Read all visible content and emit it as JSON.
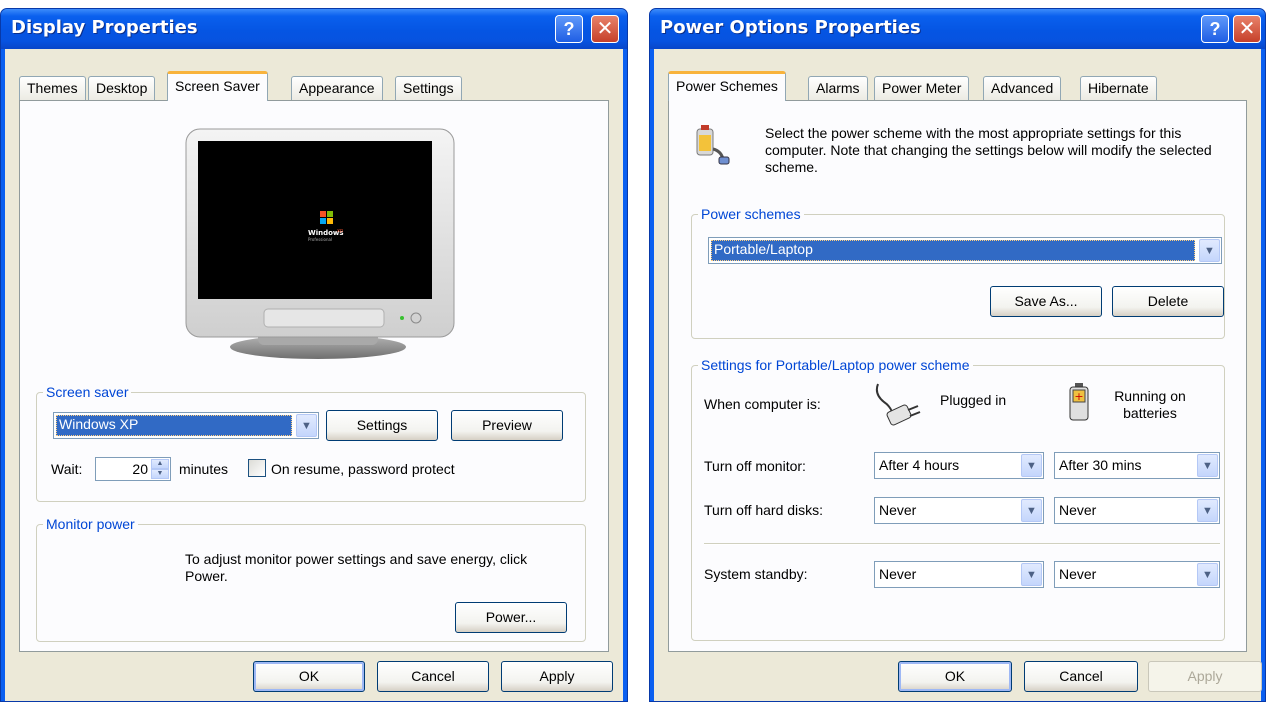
{
  "display_window": {
    "title": "Display Properties",
    "help_button": "?",
    "close_button": "✕",
    "tabs": [
      "Themes",
      "Desktop",
      "Screen Saver",
      "Appearance",
      "Settings"
    ],
    "active_tab": "Screen Saver",
    "screen_saver_group": {
      "label": "Screen saver",
      "selected": "Windows XP",
      "settings_button": "Settings",
      "preview_button": "Preview",
      "wait_label": "Wait:",
      "wait_value": "20",
      "minutes_label": "minutes",
      "password_checkbox_label": "On resume, password protect",
      "password_checked": false
    },
    "monitor_power_group": {
      "label": "Monitor power",
      "description": "To adjust monitor power settings and save energy, click Power.",
      "power_button": "Power..."
    },
    "preview_logo": {
      "line1": "Windows",
      "line2": "xp",
      "line3": "Professional"
    },
    "buttons": {
      "ok": "OK",
      "cancel": "Cancel",
      "apply": "Apply"
    }
  },
  "power_window": {
    "title": "Power Options Properties",
    "help_button": "?",
    "close_button": "✕",
    "tabs": [
      "Power Schemes",
      "Alarms",
      "Power Meter",
      "Advanced",
      "Hibernate"
    ],
    "active_tab": "Power Schemes",
    "description": "Select the power scheme with the most appropriate settings for this computer. Note that changing the settings below will modify the selected scheme.",
    "schemes_group": {
      "label": "Power schemes",
      "selected": "Portable/Laptop",
      "save_as_button": "Save As...",
      "delete_button": "Delete"
    },
    "settings_group": {
      "label": "Settings for Portable/Laptop power scheme",
      "when_label": "When computer is:",
      "plugged_in": "Plugged in",
      "batteries": "Running on batteries",
      "rows": [
        {
          "label": "Turn off monitor:",
          "plugged": "After 4 hours",
          "battery": "After 30 mins"
        },
        {
          "label": "Turn off hard disks:",
          "plugged": "Never",
          "battery": "Never"
        },
        {
          "label": "System standby:",
          "plugged": "Never",
          "battery": "Never"
        }
      ]
    },
    "buttons": {
      "ok": "OK",
      "cancel": "Cancel",
      "apply": "Apply",
      "apply_disabled": true
    }
  },
  "colors": {
    "title_bar": "#0a5ff0",
    "dialog_bg": "#ece9d8",
    "group_label": "#0046d5",
    "selection": "#316ac5",
    "tab_highlight": "#f8b33c"
  },
  "icons": [
    "help-icon",
    "close-icon",
    "dropdown-arrow-icon",
    "power-scheme-icon",
    "plug-icon",
    "battery-icon",
    "windows-logo-icon"
  ]
}
